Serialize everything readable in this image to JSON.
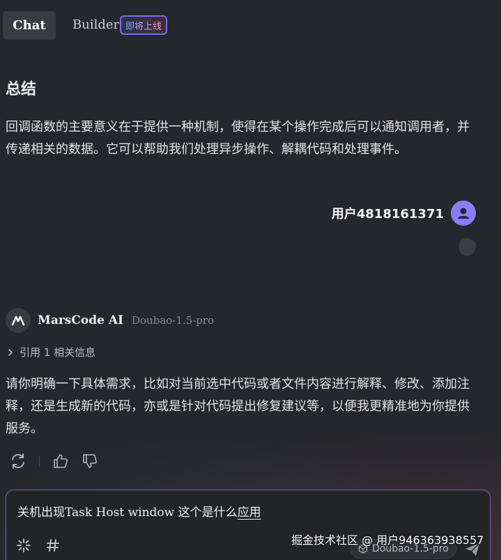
{
  "tabs": {
    "chat_label": "Chat",
    "builder_label": "Builder",
    "builder_badge": "即将上线"
  },
  "summary": {
    "title": "总结",
    "text": "回调函数的主要意义在于提供一种机制，使得在某个操作完成后可以通知调用者，并传递相关的数据。它可以帮助我们处理异步操作、解耦代码和处理事件。"
  },
  "user": {
    "name": "用户4818161371",
    "avatar_icon": "user-icon",
    "avatar_color": "#8b7cf5"
  },
  "ai": {
    "name": "MarsCode AI",
    "model": "Doubao-1.5-pro",
    "reference_label": "引用 1 相关信息",
    "reply": "请你明确一下具体需求，比如对当前选中代码或者文件内容进行解释、修改、添加注释，还是生成新的代码，亦或是针对代码提出修复建议等，以便我更精准地为你提供服务。"
  },
  "actions": {
    "regenerate_icon": "refresh-icon",
    "like_icon": "thumbs-up-icon",
    "dislike_icon": "thumbs-down-icon"
  },
  "input": {
    "value_prefix": "关机出现Task Host window 这个是什么",
    "value_underlined": "应用",
    "model_label": "Doubao-1.5-pro",
    "sparkle_icon": "sparkle-icon",
    "hash_icon": "hash-icon",
    "send_icon": "send-icon"
  },
  "watermark": "掘金技术社区 @ 用户946363938557"
}
